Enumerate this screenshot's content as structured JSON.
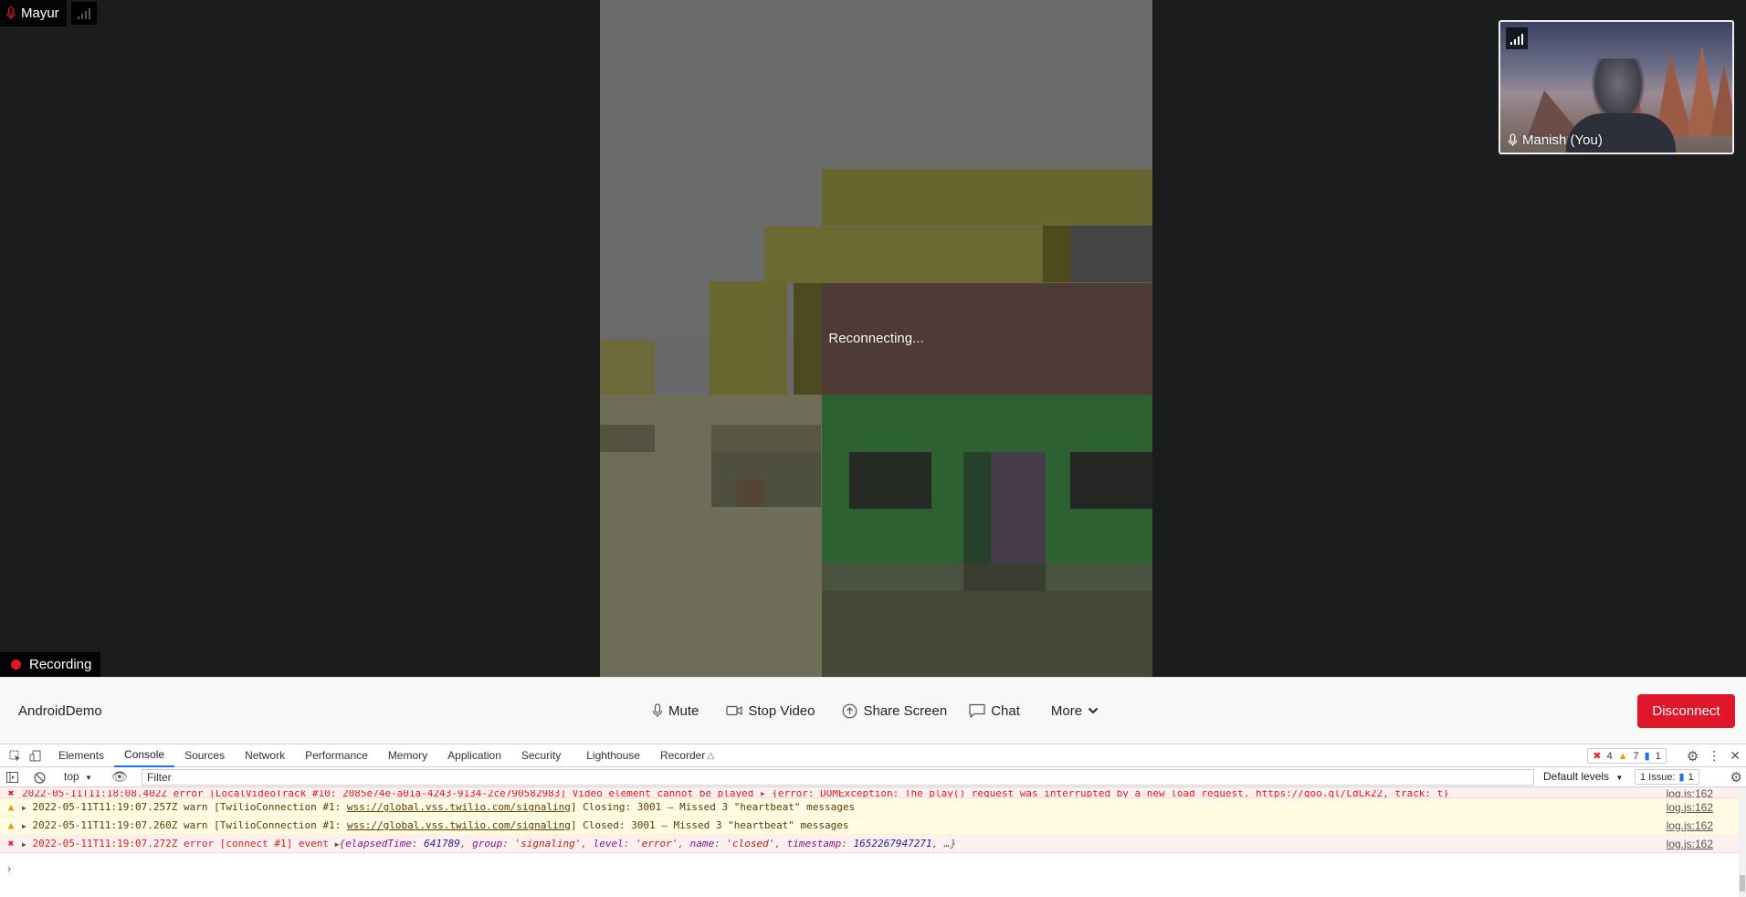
{
  "participant": {
    "name": "Mayur"
  },
  "main_video": {
    "status": "Reconnecting..."
  },
  "local_preview": {
    "label": "Manish (You)"
  },
  "recording": {
    "label": "Recording"
  },
  "control_bar": {
    "room_name": "AndroidDemo",
    "mute_label": "Mute",
    "stop_video_label": "Stop Video",
    "share_screen_label": "Share Screen",
    "chat_label": "Chat",
    "more_label": "More",
    "disconnect_label": "Disconnect"
  },
  "devtools": {
    "tabs": [
      "Elements",
      "Console",
      "Sources",
      "Network",
      "Performance",
      "Memory",
      "Application",
      "Security",
      "Lighthouse",
      "Recorder"
    ],
    "active_tab": "Console",
    "error_count": "4",
    "warning_count": "7",
    "message_count": "1",
    "context": "top",
    "filter_placeholder": "Filter",
    "default_levels": "Default levels",
    "issues_label": "1 Issue:",
    "issues_count": "1",
    "logs": [
      {
        "level": "error",
        "text": "2022-05-11T11:18:08.402Z error [LocalVideoTrack #10: 2085e74e-a01a-4243-9134-2ce790582983] Video element cannot be played ▸ {error: DOMException: The play() request was interrupted by a new load request. https://goo.gl/LdLk22, track: t}",
        "source": "log.js:162"
      },
      {
        "level": "warn",
        "timestamp": "2022-05-11T11:19:07.257Z",
        "prefix": "warn [TwilioConnection #1:",
        "url": "wss://global.vss.twilio.com/signaling",
        "message": "] Closing: 3001 – Missed 3 \"heartbeat\" messages",
        "source": "log.js:162"
      },
      {
        "level": "warn",
        "timestamp": "2022-05-11T11:19:07.260Z",
        "prefix": "warn [TwilioConnection #1:",
        "url": "wss://global.vss.twilio.com/signaling",
        "message": "] Closed: 3001 – Missed 3 \"heartbeat\" messages",
        "source": "log.js:162"
      },
      {
        "level": "error",
        "timestamp": "2022-05-11T11:19:07.272Z",
        "prefix": "error [connect #1] event",
        "object": {
          "elapsedTime": "641789",
          "group": "'signaling'",
          "level": "'error'",
          "name": "'closed'",
          "timestamp": "1652267947271",
          "more": "…"
        },
        "source": "log.js:162"
      }
    ]
  },
  "colors": {
    "accent_red": "#e0162b",
    "stage_bg": "#1b1c1e",
    "devtools_link": "#1a73e8"
  }
}
